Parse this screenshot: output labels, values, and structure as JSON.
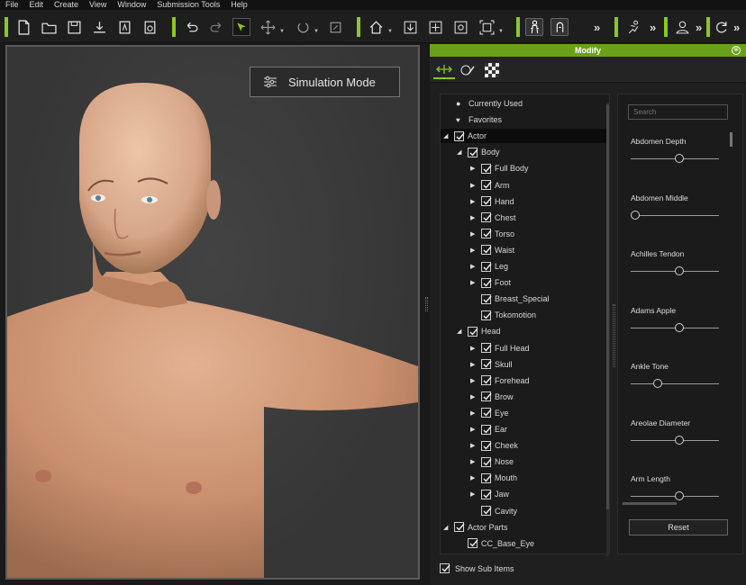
{
  "menu": [
    "File",
    "Edit",
    "Create",
    "View",
    "Window",
    "Submission Tools",
    "Help"
  ],
  "viewport": {
    "sim_mode_label": "Simulation Mode"
  },
  "panel": {
    "title": "Modify",
    "close_glyph": "⊗",
    "tabs": [
      "motion-puppet-icon",
      "morph-sliders-icon",
      "checker-texture-icon"
    ]
  },
  "tree": [
    {
      "label": "Currently Used",
      "icon": "dot",
      "depth": 0
    },
    {
      "label": "Favorites",
      "icon": "heart",
      "depth": 0
    },
    {
      "label": "Actor",
      "checked": true,
      "expanded": true,
      "depth": 0,
      "selected": true
    },
    {
      "label": "Body",
      "checked": true,
      "expanded": true,
      "depth": 1
    },
    {
      "label": "Full Body",
      "checked": true,
      "collapsed": true,
      "depth": 2
    },
    {
      "label": "Arm",
      "checked": true,
      "collapsed": true,
      "depth": 2
    },
    {
      "label": "Hand",
      "checked": true,
      "collapsed": true,
      "depth": 2
    },
    {
      "label": "Chest",
      "checked": true,
      "collapsed": true,
      "depth": 2
    },
    {
      "label": "Torso",
      "checked": true,
      "collapsed": true,
      "depth": 2
    },
    {
      "label": "Waist",
      "checked": true,
      "collapsed": true,
      "depth": 2
    },
    {
      "label": "Leg",
      "checked": true,
      "collapsed": true,
      "depth": 2
    },
    {
      "label": "Foot",
      "checked": true,
      "collapsed": true,
      "depth": 2
    },
    {
      "label": "Breast_Special",
      "checked": true,
      "depth": 2
    },
    {
      "label": "Tokomotion",
      "checked": true,
      "depth": 2
    },
    {
      "label": "Head",
      "checked": true,
      "expanded": true,
      "depth": 1
    },
    {
      "label": "Full Head",
      "checked": true,
      "collapsed": true,
      "depth": 2
    },
    {
      "label": "Skull",
      "checked": true,
      "collapsed": true,
      "depth": 2
    },
    {
      "label": "Forehead",
      "checked": true,
      "collapsed": true,
      "depth": 2
    },
    {
      "label": "Brow",
      "checked": true,
      "collapsed": true,
      "depth": 2
    },
    {
      "label": "Eye",
      "checked": true,
      "collapsed": true,
      "depth": 2
    },
    {
      "label": "Ear",
      "checked": true,
      "collapsed": true,
      "depth": 2
    },
    {
      "label": "Cheek",
      "checked": true,
      "collapsed": true,
      "depth": 2
    },
    {
      "label": "Nose",
      "checked": true,
      "collapsed": true,
      "depth": 2
    },
    {
      "label": "Mouth",
      "checked": true,
      "collapsed": true,
      "depth": 2
    },
    {
      "label": "Jaw",
      "checked": true,
      "collapsed": true,
      "depth": 2
    },
    {
      "label": "Cavity",
      "checked": true,
      "depth": 2
    },
    {
      "label": "Actor Parts",
      "checked": true,
      "expanded": true,
      "depth": 0
    },
    {
      "label": "CC_Base_Eye",
      "checked": true,
      "depth": 1
    }
  ],
  "search": {
    "placeholder": "Search"
  },
  "sliders": [
    {
      "name": "Abdomen Depth",
      "value": 0.5
    },
    {
      "name": "Abdomen Middle",
      "value": 0.0
    },
    {
      "name": "Achilles Tendon",
      "value": 0.5
    },
    {
      "name": "Adams Apple",
      "value": 0.5
    },
    {
      "name": "Ankle Tone",
      "value": 0.25
    },
    {
      "name": "Areolae Diameter",
      "value": 0.5
    },
    {
      "name": "Arm Length",
      "value": 0.5
    }
  ],
  "reset_label": "Reset",
  "show_sub_items": {
    "label": "Show Sub Items",
    "checked": true
  }
}
